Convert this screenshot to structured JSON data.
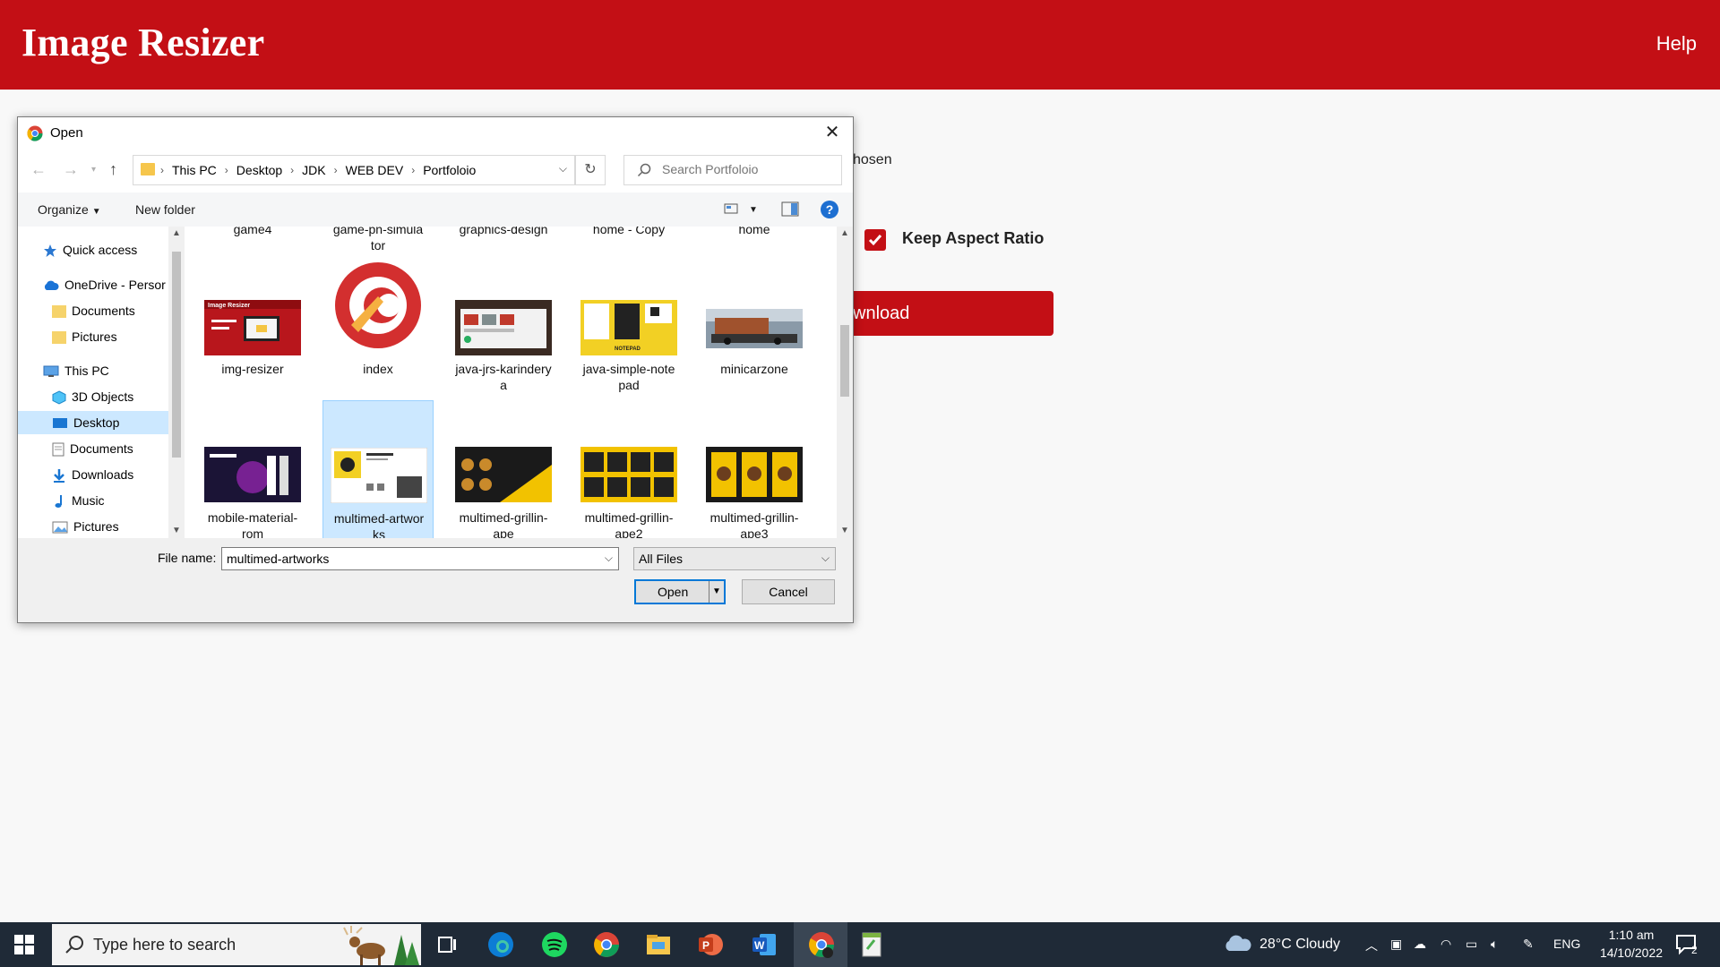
{
  "app": {
    "title": "Image Resizer",
    "help": "Help",
    "file_status_fragment": "hosen",
    "keep_aspect_label": "Keep Aspect Ratio",
    "download_fragment": "wnload"
  },
  "dialog": {
    "title": "Open",
    "breadcrumbs": [
      "This PC",
      "Desktop",
      "JDK",
      "WEB DEV",
      "Portfoloio"
    ],
    "search_placeholder": "Search Portfoloio",
    "toolbar": {
      "organize": "Organize",
      "new_folder": "New folder"
    },
    "nav_items": [
      {
        "label": "Quick access",
        "icon": "star-icon"
      },
      {
        "label": "OneDrive - Persor",
        "icon": "cloud-icon"
      },
      {
        "label": "Documents",
        "icon": "folder-icon"
      },
      {
        "label": "Pictures",
        "icon": "folder-icon"
      },
      {
        "label": "This PC",
        "icon": "computer-icon"
      },
      {
        "label": "3D Objects",
        "icon": "cube-icon"
      },
      {
        "label": "Desktop",
        "icon": "desktop-icon"
      },
      {
        "label": "Documents",
        "icon": "document-icon"
      },
      {
        "label": "Downloads",
        "icon": "download-icon"
      },
      {
        "label": "Music",
        "icon": "music-icon"
      },
      {
        "label": "Pictures",
        "icon": "pictures-icon"
      }
    ],
    "files_row0": [
      "game4",
      "game-pn-simulator",
      "graphics-design",
      "home - Copy",
      "home"
    ],
    "files_row0_wrap": [
      "",
      "tor",
      "",
      "",
      ""
    ],
    "files_row0_top": [
      "game4",
      "game-pn-simula",
      "graphics-design",
      "home - Copy",
      "home"
    ],
    "files_row1": [
      {
        "l1": "img-resizer",
        "l2": ""
      },
      {
        "l1": "index",
        "l2": ""
      },
      {
        "l1": "java-jrs-karindery",
        "l2": "a"
      },
      {
        "l1": "java-simple-note",
        "l2": "pad"
      },
      {
        "l1": "minicarzone",
        "l2": ""
      }
    ],
    "files_row2": [
      {
        "l1": "mobile-material-",
        "l2": "rom"
      },
      {
        "l1": "multimed-artwor",
        "l2": "ks"
      },
      {
        "l1": "multimed-grillin-",
        "l2": "ape"
      },
      {
        "l1": "multimed-grillin-",
        "l2": "ape2"
      },
      {
        "l1": "multimed-grillin-",
        "l2": "ape3"
      }
    ],
    "thumb_texts": {
      "img_resizer": "Image Resizer",
      "notepad": "NOTEPAD"
    },
    "file_name_label": "File name:",
    "file_name_value": "multimed-artworks",
    "file_type": "All Files",
    "open_label": "Open",
    "cancel_label": "Cancel"
  },
  "taskbar": {
    "search_placeholder": "Type here to search",
    "weather": "28°C  Cloudy",
    "language": "ENG",
    "time": "1:10 am",
    "date": "14/10/2022",
    "notifications": "2"
  },
  "colors": {
    "brand_red": "#c30f15",
    "selection": "#cce8ff",
    "accent_blue": "#0078d7"
  }
}
